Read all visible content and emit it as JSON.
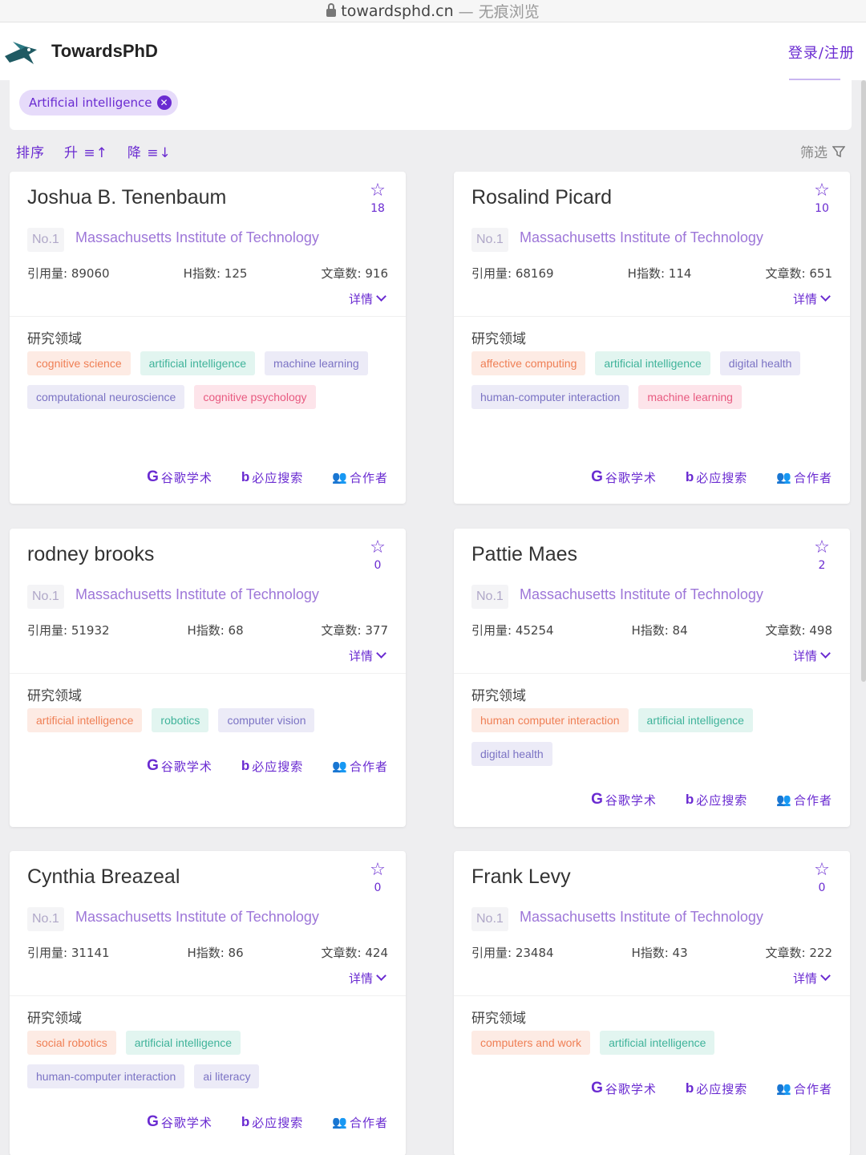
{
  "browser": {
    "domain": "towardsphd.cn",
    "mode": "— 无痕浏览"
  },
  "header": {
    "brand": "TowardsPhD",
    "login": "登录/注册"
  },
  "filter": {
    "chip": "Artificial intelligence"
  },
  "sort": {
    "label": "排序",
    "asc": "升",
    "desc": "降",
    "filter": "筛选"
  },
  "labels": {
    "citations": "引用量",
    "hindex": "H指数",
    "papers": "文章数",
    "details": "详情",
    "research_area": "研究领域",
    "scholar": "谷歌学术",
    "bing": "必应搜索",
    "coauthors": "合作者"
  },
  "cards": [
    {
      "name": "Joshua B. Tenenbaum",
      "stars": "18",
      "rank": "No.1",
      "institution": "Massachusetts Institute of Technology",
      "citations": "引用量: 89060",
      "hindex": "H指数: 125",
      "papers": "文章数: 916",
      "tags": [
        {
          "text": "cognitive science",
          "c": "orange"
        },
        {
          "text": "artificial intelligence",
          "c": "teal"
        },
        {
          "text": "machine learning",
          "c": "purple"
        },
        {
          "text": "computational neuroscience",
          "c": "purple"
        },
        {
          "text": "cognitive psychology",
          "c": "pink"
        }
      ]
    },
    {
      "name": "Rosalind Picard",
      "stars": "10",
      "rank": "No.1",
      "institution": "Massachusetts Institute of Technology",
      "citations": "引用量: 68169",
      "hindex": "H指数: 114",
      "papers": "文章数: 651",
      "tags": [
        {
          "text": "affective computing",
          "c": "orange"
        },
        {
          "text": "artificial intelligence",
          "c": "teal"
        },
        {
          "text": "digital health",
          "c": "purple"
        },
        {
          "text": "human-computer interaction",
          "c": "purple"
        },
        {
          "text": "machine learning",
          "c": "pink"
        }
      ]
    },
    {
      "name": "rodney brooks",
      "stars": "0",
      "rank": "No.1",
      "institution": "Massachusetts Institute of Technology",
      "citations": "引用量: 51932",
      "hindex": "H指数: 68",
      "papers": "文章数: 377",
      "tags": [
        {
          "text": "artificial intelligence",
          "c": "orange"
        },
        {
          "text": "robotics",
          "c": "teal"
        },
        {
          "text": "computer vision",
          "c": "purple"
        }
      ]
    },
    {
      "name": "Pattie Maes",
      "stars": "2",
      "rank": "No.1",
      "institution": "Massachusetts Institute of Technology",
      "citations": "引用量: 45254",
      "hindex": "H指数: 84",
      "papers": "文章数: 498",
      "tags": [
        {
          "text": "human computer interaction",
          "c": "orange"
        },
        {
          "text": "artificial intelligence",
          "c": "teal"
        },
        {
          "text": "digital health",
          "c": "purple"
        }
      ]
    },
    {
      "name": "Cynthia Breazeal",
      "stars": "0",
      "rank": "No.1",
      "institution": "Massachusetts Institute of Technology",
      "citations": "引用量: 31141",
      "hindex": "H指数: 86",
      "papers": "文章数: 424",
      "tags": [
        {
          "text": "social robotics",
          "c": "orange"
        },
        {
          "text": "artificial intelligence",
          "c": "teal"
        },
        {
          "text": "human-computer interaction",
          "c": "purple"
        },
        {
          "text": "ai literacy",
          "c": "purple"
        }
      ]
    },
    {
      "name": "Frank Levy",
      "stars": "0",
      "rank": "No.1",
      "institution": "Massachusetts Institute of Technology",
      "citations": "引用量: 23484",
      "hindex": "H指数: 43",
      "papers": "文章数: 222",
      "tags": [
        {
          "text": "computers and work",
          "c": "orange"
        },
        {
          "text": "artificial intelligence",
          "c": "teal"
        }
      ]
    }
  ]
}
